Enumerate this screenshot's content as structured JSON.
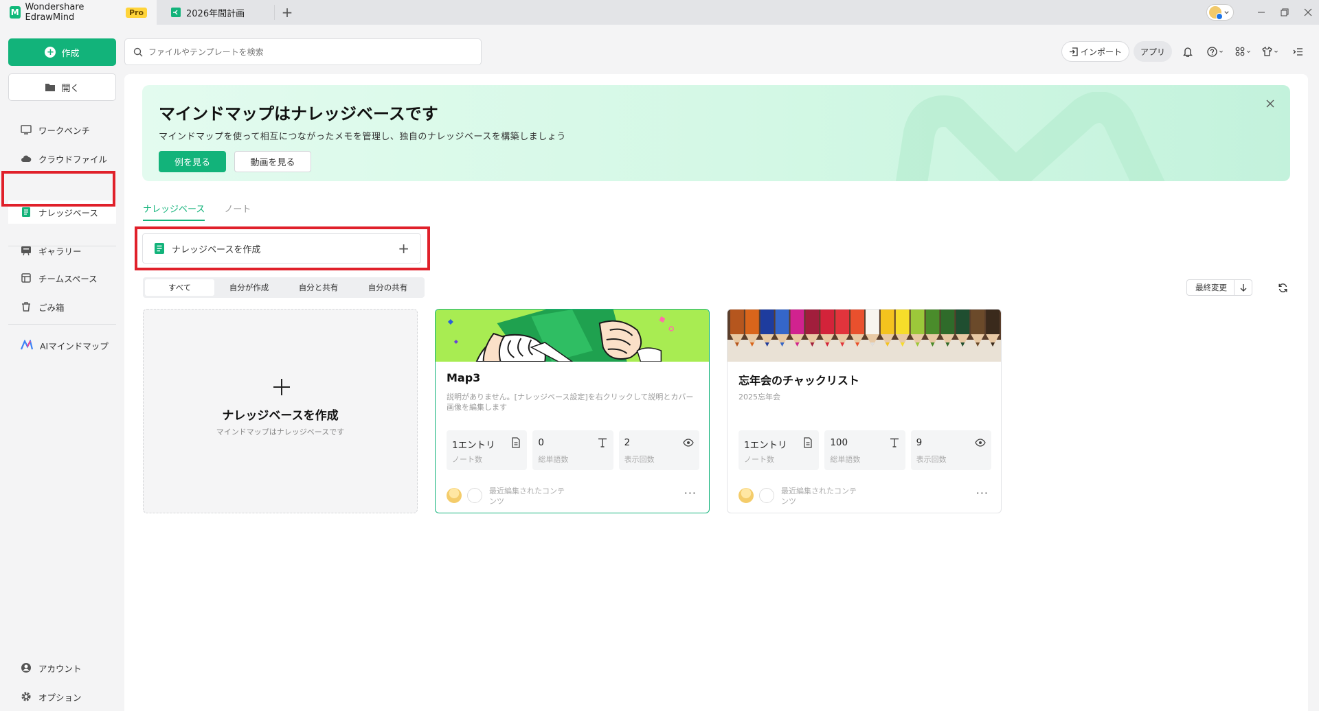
{
  "titlebar": {
    "app_tab": "Wondershare EdrawMind",
    "pro_badge": "Pro",
    "doc_tab": "2026年間計画"
  },
  "sidebar": {
    "create_label": "作成",
    "open_label": "開く",
    "items": [
      {
        "label": "ワークベンチ",
        "icon": "workbench-icon"
      },
      {
        "label": "クラウドファイル",
        "icon": "cloud-icon"
      },
      {
        "label": "ナレッジベース",
        "icon": "knowledge-base-icon"
      },
      {
        "label": "ギャラリー",
        "icon": "gallery-icon"
      },
      {
        "label": "チームスペース",
        "icon": "team-icon"
      },
      {
        "label": "ごみ箱",
        "icon": "trash-icon"
      },
      {
        "label": "AIマインドマップ",
        "icon": "ai-mindmap-icon"
      }
    ],
    "bottom": [
      {
        "label": "アカウント",
        "icon": "account-icon"
      },
      {
        "label": "オプション",
        "icon": "gear-icon"
      }
    ]
  },
  "search": {
    "placeholder": "ファイルやテンプレートを検索"
  },
  "topbar": {
    "import_label": "インポート",
    "app_label": "アプリ"
  },
  "banner": {
    "title": "マインドマップはナレッジベースです",
    "subtitle": "マインドマップを使って相互につながったメモを管理し、独自のナレッジベースを構築しましょう",
    "btn_example": "例を見る",
    "btn_video": "動画を見る"
  },
  "tabs": [
    "ナレッジベース",
    "ノート"
  ],
  "create_kb_label": "ナレッジベースを作成",
  "filters": [
    "すべて",
    "自分が作成",
    "自分と共有",
    "自分の共有"
  ],
  "sort_label": "最終変更",
  "new_card": {
    "title": "ナレッジベースを作成",
    "subtitle": "マインドマップはナレッジベースです"
  },
  "cards": [
    {
      "title": "Map3",
      "desc": "説明がありません。[ナレッジベース設定]を右クリックして説明とカバー画像を編集します",
      "stats": [
        {
          "value": "1エントリ",
          "label": "ノート数"
        },
        {
          "value": "0",
          "label": "総単語数"
        },
        {
          "value": "2",
          "label": "表示回数"
        }
      ],
      "footer": "最近編集されたコンテンツ",
      "more": "···"
    },
    {
      "title": "忘年会のチャックリスト",
      "desc": "2025忘年会",
      "stats": [
        {
          "value": "1エントリ",
          "label": "ノート数"
        },
        {
          "value": "100",
          "label": "総単語数"
        },
        {
          "value": "9",
          "label": "表示回数"
        }
      ],
      "footer": "最近編集されたコンテンツ",
      "more": "···"
    }
  ],
  "colors": {
    "accent": "#12b37a",
    "highlight": "#e0202a"
  }
}
